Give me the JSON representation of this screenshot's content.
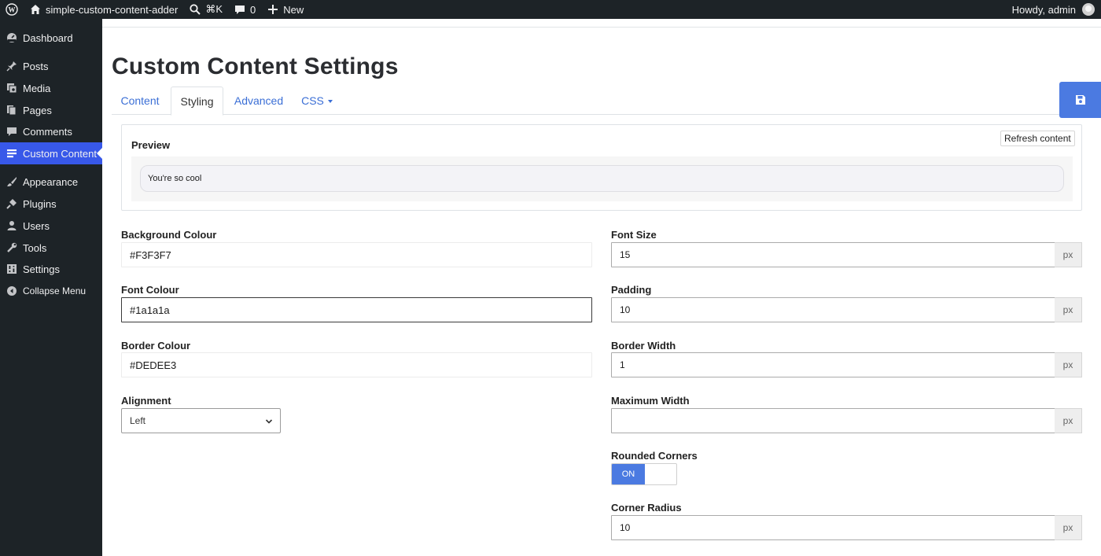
{
  "adminbar": {
    "site_name": "simple-custom-content-adder",
    "search_shortcut": "⌘K",
    "comments_count": "0",
    "new_label": "New",
    "greeting": "Howdy, admin"
  },
  "sidebar": {
    "items": [
      {
        "label": "Dashboard",
        "icon": "dashboard-icon"
      },
      {
        "label": "Posts",
        "icon": "pin-icon"
      },
      {
        "label": "Media",
        "icon": "media-icon"
      },
      {
        "label": "Pages",
        "icon": "pages-icon"
      },
      {
        "label": "Comments",
        "icon": "comment-icon"
      },
      {
        "label": "Custom Content",
        "icon": "list-icon",
        "active": true
      },
      {
        "label": "Appearance",
        "icon": "brush-icon"
      },
      {
        "label": "Plugins",
        "icon": "plug-icon"
      },
      {
        "label": "Users",
        "icon": "user-icon"
      },
      {
        "label": "Tools",
        "icon": "wrench-icon"
      },
      {
        "label": "Settings",
        "icon": "settings-icon"
      },
      {
        "label": "Collapse Menu",
        "icon": "collapse-icon"
      }
    ]
  },
  "page": {
    "title": "Custom Content Settings"
  },
  "tabs": [
    {
      "label": "Content"
    },
    {
      "label": "Styling",
      "active": true
    },
    {
      "label": "Advanced"
    },
    {
      "label": "CSS"
    }
  ],
  "preview": {
    "title": "Preview",
    "refresh_label": "Refresh content",
    "content_text": "You're so cool"
  },
  "form": {
    "background_colour": {
      "label": "Background Colour",
      "value": "#F3F3F7"
    },
    "font_colour": {
      "label": "Font Colour",
      "value": "#1a1a1a"
    },
    "border_colour": {
      "label": "Border Colour",
      "value": "#DEDEE3"
    },
    "alignment": {
      "label": "Alignment",
      "value": "Left"
    },
    "font_size": {
      "label": "Font Size",
      "value": "15",
      "unit": "px"
    },
    "padding": {
      "label": "Padding",
      "value": "10",
      "unit": "px"
    },
    "border_width": {
      "label": "Border Width",
      "value": "1",
      "unit": "px"
    },
    "max_width": {
      "label": "Maximum Width",
      "value": "",
      "unit": "px"
    },
    "rounded_corners": {
      "label": "Rounded Corners",
      "state": "ON"
    },
    "corner_radius": {
      "label": "Corner Radius",
      "value": "10",
      "unit": "px"
    }
  },
  "colors": {
    "admin_dark": "#1d2327",
    "accent_blue": "#4b7ae1",
    "menu_active": "#3858e9",
    "link_blue": "#3b6fd6"
  }
}
